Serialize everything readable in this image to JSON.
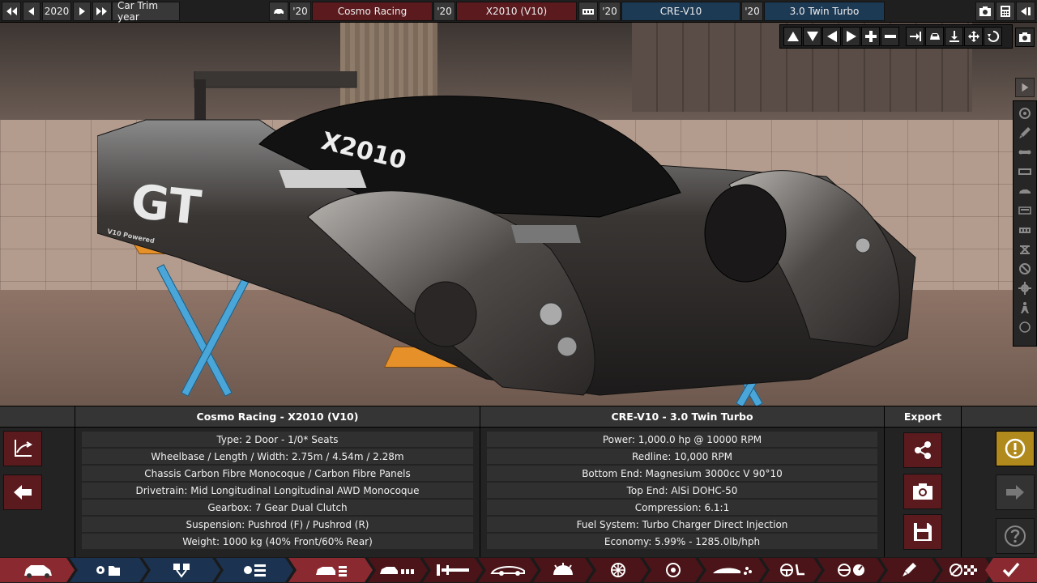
{
  "topbar": {
    "year": "2020",
    "trim_label": "Car Trim year",
    "model_year": "'20",
    "company": "Cosmo Racing",
    "trim_year": "'20",
    "model": "X2010 (V10)",
    "engine_year": "'20",
    "engine_family": "CRE-V10",
    "variant_year": "'20",
    "variant": "3.0 Twin Turbo"
  },
  "car_info": {
    "title": "Cosmo Racing - X2010 (V10)",
    "rows": [
      "Type: 2 Door - 1/0* Seats",
      "Wheelbase / Length / Width: 2.75m / 4.54m / 2.28m",
      "Chassis Carbon Fibre Monocoque / Carbon Fibre Panels",
      "Drivetrain: Mid Longitudinal Longitudinal AWD Monocoque",
      "Gearbox: 7 Gear Dual Clutch",
      "Suspension: Pushrod (F) / Pushrod (R)",
      "Weight: 1000 kg (40% Front/60% Rear)"
    ]
  },
  "engine_info": {
    "title": "CRE-V10 - 3.0 Twin Turbo",
    "rows": [
      "Power: 1,000.0 hp @ 10000 RPM",
      "Redline:  10,000 RPM",
      "Bottom End: Magnesium 3000cc V 90°10",
      "Top End: AlSi DOHC-50",
      "Compression: 6.1:1",
      "Fuel System: Turbo Charger Direct Injection",
      "Economy: 5.99% - 1285.0lb/hph"
    ]
  },
  "export": {
    "title": "Export"
  },
  "car_decals": {
    "side": "GT",
    "side_small": "V10 Powered",
    "nose": "X2010"
  },
  "colors": {
    "accent_red": "#5a1a1e",
    "accent_blue": "#1b3350",
    "warning_gold": "#b08a1c"
  }
}
